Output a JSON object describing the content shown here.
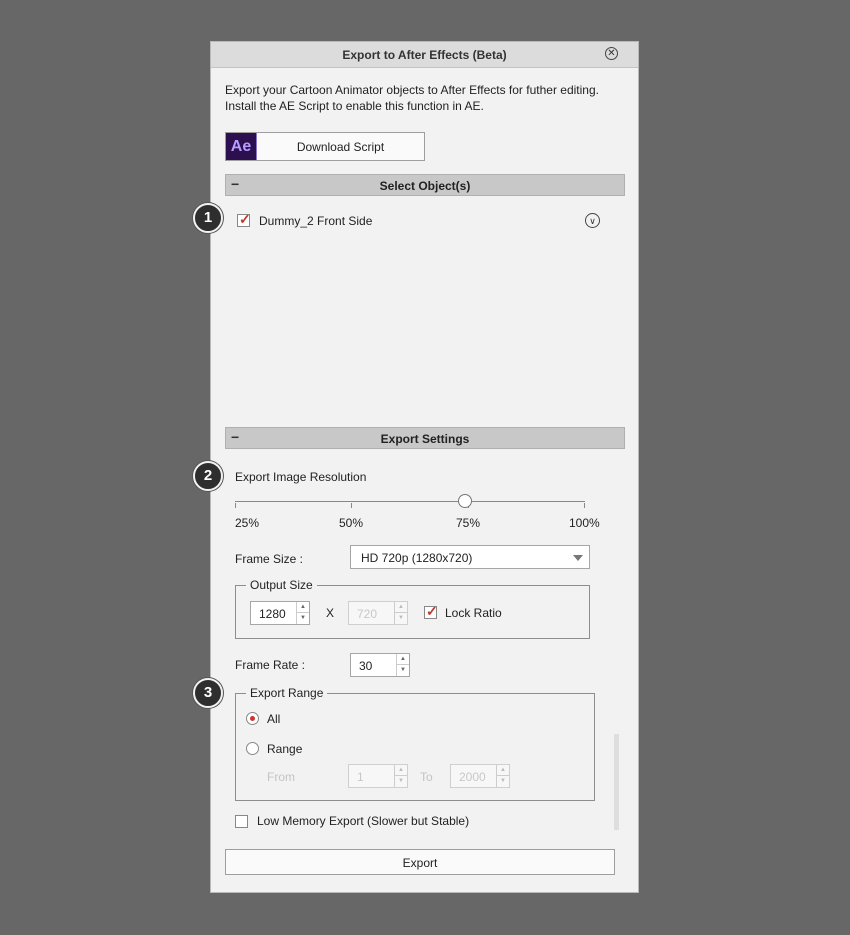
{
  "dialog": {
    "title": "Export to After Effects (Beta)",
    "close_icon": "close-circle-icon",
    "intro_line1": "Export your Cartoon Animator objects to After Effects for futher editing.",
    "intro_line2": "Install the AE Script to enable this function in AE.",
    "download_button": {
      "logo": "Ae",
      "label": "Download Script"
    }
  },
  "select_objects": {
    "header": "Select Object(s)",
    "collapse_symbol": "−",
    "items": [
      {
        "label": "Dummy_2 Front Side",
        "checked": true
      }
    ]
  },
  "export_settings": {
    "header": "Export Settings",
    "collapse_symbol": "−",
    "resolution": {
      "label": "Export Image Resolution",
      "ticks": [
        "25%",
        "50%",
        "75%",
        "100%"
      ],
      "value_percent": 75
    },
    "frame_size": {
      "label": "Frame Size :",
      "value": "HD 720p (1280x720)"
    },
    "output_size": {
      "legend": "Output Size",
      "width": "1280",
      "separator": "X",
      "height": "720",
      "lock_ratio_label": "Lock Ratio",
      "lock_ratio_checked": true
    },
    "frame_rate": {
      "label": "Frame Rate :",
      "value": "30"
    },
    "export_range": {
      "legend": "Export Range",
      "options": [
        "All",
        "Range"
      ],
      "selected": "All",
      "from_label": "From",
      "from_value": "1",
      "to_label": "To",
      "to_value": "2000"
    },
    "low_memory": {
      "label": "Low Memory Export (Slower but Stable)",
      "checked": false
    }
  },
  "export_button": "Export",
  "callouts": [
    "1",
    "2",
    "3"
  ],
  "colors": {
    "background": "#676767",
    "panel": "#f2f2f2",
    "header": "#c8c8c8",
    "accent": "#d0352e",
    "ae_logo": "#2b0f4f"
  }
}
